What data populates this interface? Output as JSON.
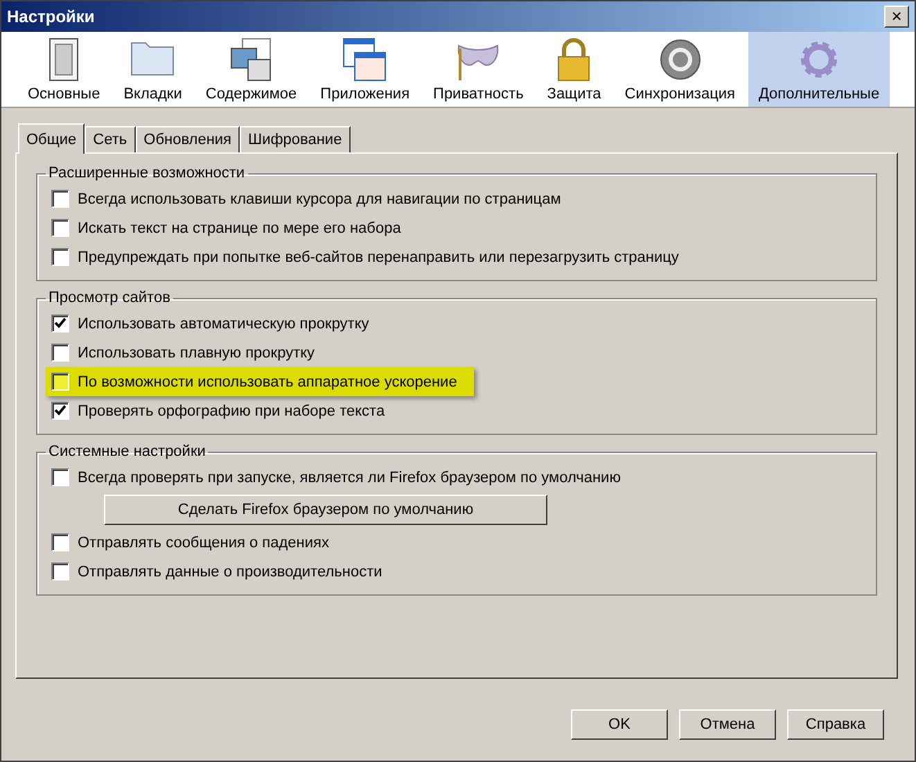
{
  "window": {
    "title": "Настройки",
    "close": "×"
  },
  "panes": [
    {
      "label": "Основные",
      "selected": false
    },
    {
      "label": "Вкладки",
      "selected": false
    },
    {
      "label": "Содержимое",
      "selected": false
    },
    {
      "label": "Приложения",
      "selected": false
    },
    {
      "label": "Приватность",
      "selected": false
    },
    {
      "label": "Защита",
      "selected": false
    },
    {
      "label": "Синхронизация",
      "selected": false
    },
    {
      "label": "Дополнительные",
      "selected": true
    }
  ],
  "tabs": [
    {
      "label": "Общие",
      "selected": true
    },
    {
      "label": "Сеть",
      "selected": false
    },
    {
      "label": "Обновления",
      "selected": false
    },
    {
      "label": "Шифрование",
      "selected": false
    }
  ],
  "groups": [
    {
      "title": "Расширенные возможности",
      "items": [
        {
          "kind": "checkbox",
          "label": "Всегда использовать клавиши курсора для навигации по страницам",
          "checked": false,
          "highlighted": false
        },
        {
          "kind": "checkbox",
          "label": "Искать текст на странице по мере его набора",
          "checked": false,
          "highlighted": false
        },
        {
          "kind": "checkbox",
          "label": "Предупреждать при попытке веб-сайтов перенаправить или перезагрузить страницу",
          "checked": false,
          "highlighted": false
        }
      ]
    },
    {
      "title": "Просмотр сайтов",
      "items": [
        {
          "kind": "checkbox",
          "label": "Использовать автоматическую прокрутку",
          "checked": true,
          "highlighted": false
        },
        {
          "kind": "checkbox",
          "label": "Использовать плавную прокрутку",
          "checked": false,
          "highlighted": false
        },
        {
          "kind": "checkbox",
          "label": "По возможности использовать аппаратное ускорение",
          "checked": false,
          "highlighted": true
        },
        {
          "kind": "checkbox",
          "label": "Проверять орфографию при наборе текста",
          "checked": true,
          "highlighted": false
        }
      ]
    },
    {
      "title": "Системные настройки",
      "items": [
        {
          "kind": "checkbox",
          "label": "Всегда проверять при запуске, является ли Firefox браузером по умолчанию",
          "checked": false,
          "highlighted": false
        },
        {
          "kind": "button",
          "label": "Сделать Firefox браузером по умолчанию"
        },
        {
          "kind": "checkbox",
          "label": "Отправлять сообщения о падениях",
          "checked": false,
          "highlighted": false
        },
        {
          "kind": "checkbox",
          "label": "Отправлять данные о производительности",
          "checked": false,
          "highlighted": false
        }
      ]
    }
  ],
  "buttons": [
    "OK",
    "Отмена",
    "Справка"
  ]
}
